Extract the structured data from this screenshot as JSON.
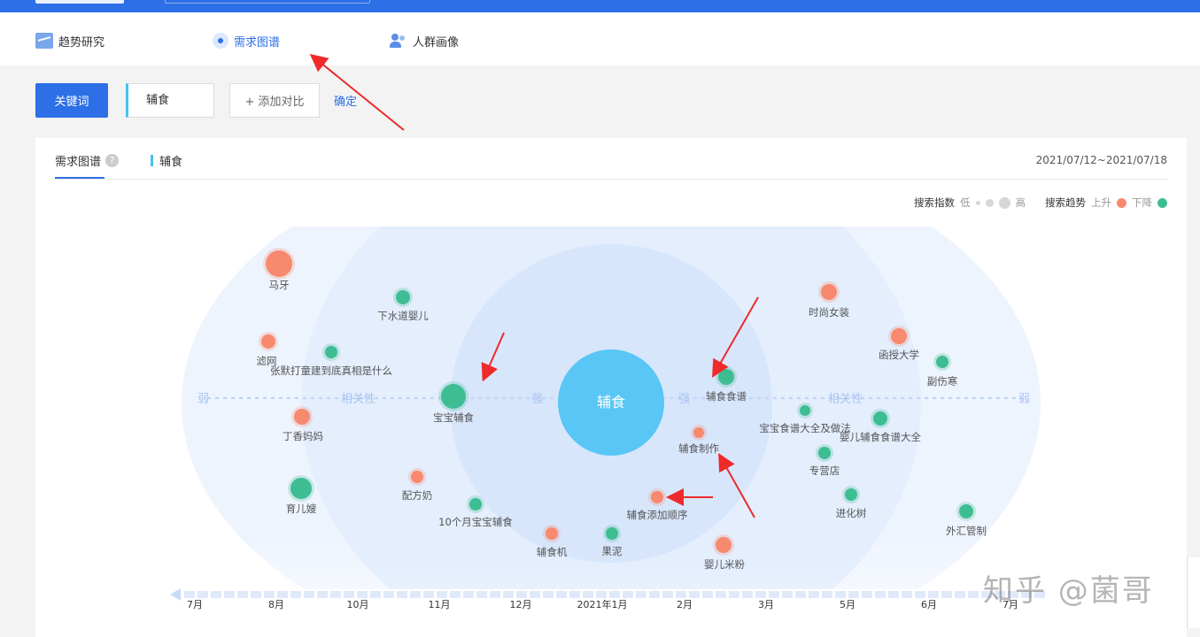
{
  "nav": {
    "items": [
      {
        "label": "趋势研究",
        "icon": "trend-chart-icon",
        "active": false
      },
      {
        "label": "需求图谱",
        "icon": "demand-map-icon",
        "active": true
      },
      {
        "label": "人群画像",
        "icon": "people-icon",
        "active": false
      }
    ]
  },
  "toolbar": {
    "keyword_button": "关键词",
    "keyword_value": "辅食",
    "add_compare": "+ 添加对比",
    "confirm": "确定"
  },
  "panel": {
    "tab_title": "需求图谱",
    "tab_help": "?",
    "keyword_tab": "辅食",
    "date_range": "2021/07/12~2021/07/18",
    "legend": {
      "search_index_label": "搜索指数",
      "low": "低",
      "high": "高",
      "trend_label": "搜索趋势",
      "up": "上升",
      "down": "下降",
      "up_color": "#f7896f",
      "down_color": "#3ebd93"
    }
  },
  "chart_data": {
    "type": "bubble-map",
    "center": "辅食",
    "axis_labels": {
      "weak": "弱",
      "relevance": "相关性",
      "strong": "强"
    },
    "keywords": [
      {
        "name": "马牙",
        "trend": "up"
      },
      {
        "name": "下水道婴儿",
        "trend": "down"
      },
      {
        "name": "滤网",
        "trend": "up"
      },
      {
        "name": "张默打童建到底真相是什么",
        "trend": "down"
      },
      {
        "name": "宝宝辅食",
        "trend": "down"
      },
      {
        "name": "丁香妈妈",
        "trend": "up"
      },
      {
        "name": "育儿嫂",
        "trend": "down"
      },
      {
        "name": "配方奶",
        "trend": "up"
      },
      {
        "name": "10个月宝宝辅食",
        "trend": "down"
      },
      {
        "name": "辅食机",
        "trend": "up"
      },
      {
        "name": "果泥",
        "trend": "down"
      },
      {
        "name": "辅食添加顺序",
        "trend": "up"
      },
      {
        "name": "婴儿米粉",
        "trend": "up"
      },
      {
        "name": "辅食制作",
        "trend": "up"
      },
      {
        "name": "辅食食谱",
        "trend": "down"
      },
      {
        "name": "时尚女装",
        "trend": "up"
      },
      {
        "name": "函授大学",
        "trend": "up"
      },
      {
        "name": "副伤寒",
        "trend": "down"
      },
      {
        "name": "宝宝食谱大全及做法",
        "trend": "down"
      },
      {
        "name": "婴儿辅食食谱大全",
        "trend": "down"
      },
      {
        "name": "专营店",
        "trend": "down"
      },
      {
        "name": "进化树",
        "trend": "down"
      },
      {
        "name": "外汇管制",
        "trend": "down"
      }
    ],
    "timeline_labels": [
      "7月",
      "8月",
      "10月",
      "11月",
      "12月",
      "2021年1月",
      "2月",
      "3月",
      "5月",
      "6月",
      "7月"
    ]
  },
  "watermark": "知乎 @菌哥"
}
